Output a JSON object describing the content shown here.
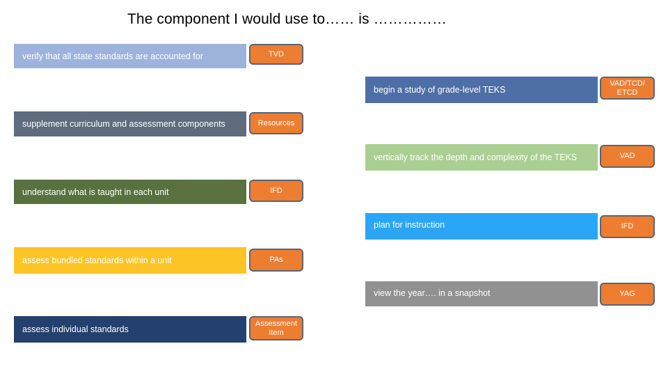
{
  "title": "The component I would use to……  is ……………",
  "left_rows": [
    {
      "task": "verify that all state standards are accounted for",
      "component": "TVD",
      "bar_color": "#9DB3DC"
    },
    {
      "task": "supplement curriculum and assessment components",
      "component": "Resources",
      "bar_color": "#5F6B7E"
    },
    {
      "task": "understand what is taught in each unit",
      "component": "IFD",
      "bar_color": "#58713F"
    },
    {
      "task": "assess bundled standards within a unit",
      "component": "PAs",
      "bar_color": "#FCC525"
    },
    {
      "task": "assess individual standards",
      "component": "Assessment Item",
      "bar_color": "#23406F"
    }
  ],
  "right_rows": [
    {
      "task": "begin a study of grade-level TEKS",
      "component": "VAD/TCD/ ETCD",
      "bar_color": "#4E6FA6"
    },
    {
      "task": "vertically track the depth and complexity of the TEKS",
      "component": "VAD",
      "bar_color": "#AACF92"
    },
    {
      "task": "plan for instruction",
      "component": "IFD",
      "bar_color": "#2AA6F6"
    },
    {
      "task": "view the year…. in a snapshot",
      "component": "YAG",
      "bar_color": "#919191"
    }
  ],
  "pill_color": "#ED7D31",
  "pill_border_color": "#5A6475"
}
